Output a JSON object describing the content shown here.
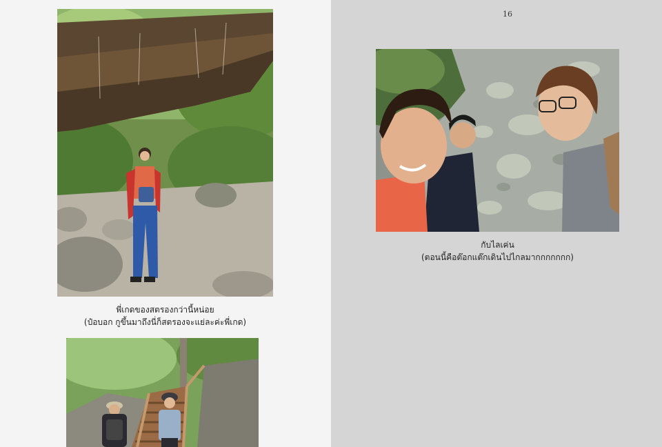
{
  "left_page": {
    "photo1_alt": "Woman standing under a large rock overhang on a forest trail",
    "caption1_line1": "พี่เกดของสตรองกว่านี้หน่อย",
    "caption1_line2": "(ป๋อบอก กูขึ้นมาถึงนี่ก็สตรองจะแย่ละค่ะพี่เกด)",
    "photo2_alt": "Hikers climbing wooden stairs through the forest"
  },
  "right_page": {
    "page_number": "16",
    "photo_alt": "Selfie of three friends in front of a lichen-covered rock face",
    "caption_line1": "กับไลเค่น",
    "caption_line2": "(ตอนนี้คือต๊อกแต๊กเดินไปไกลมากกกกกกก)"
  }
}
